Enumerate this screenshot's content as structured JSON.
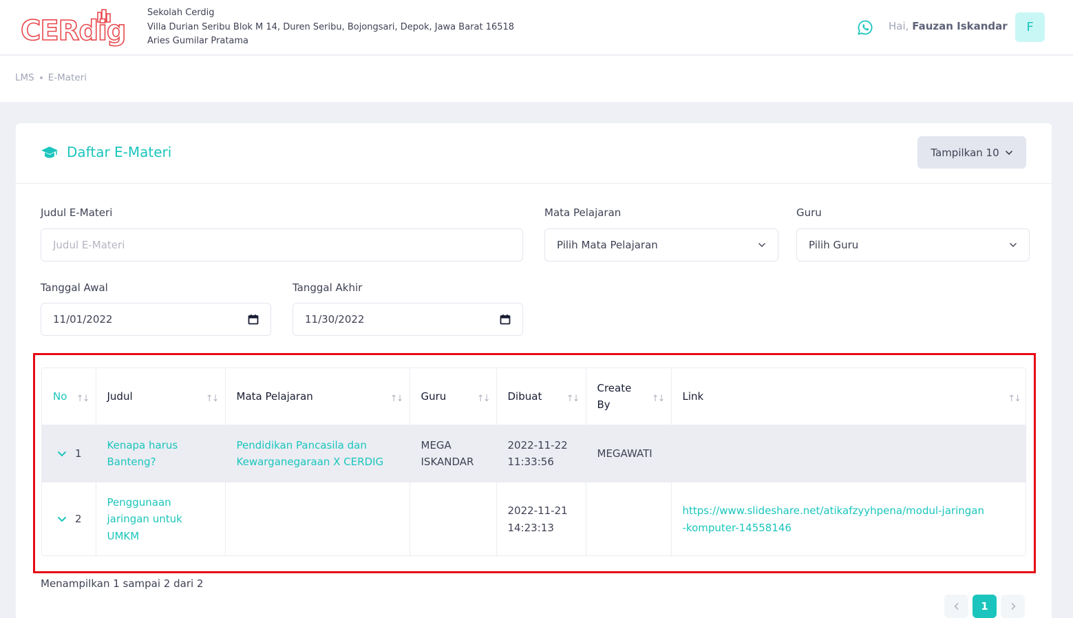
{
  "header": {
    "logo_text": "CERdig",
    "school_name": "Sekolah Cerdig",
    "school_address": "Villa Durian Seribu Blok M 14, Duren Seribu, Bojongsari, Depok, Jawa Barat 16518",
    "principal": "Aries Gumilar Pratama",
    "greeting": "Hai,",
    "user_name": "Fauzan Iskandar",
    "avatar_initial": "F"
  },
  "breadcrumb": [
    "LMS",
    "E-Materi"
  ],
  "card": {
    "title": "Daftar E-Materi",
    "show_button": "Tampilkan 10"
  },
  "filters": {
    "judul_label": "Judul E-Materi",
    "judul_placeholder": "Judul E-Materi",
    "mapel_label": "Mata Pelajaran",
    "mapel_value": "Pilih Mata Pelajaran",
    "guru_label": "Guru",
    "guru_value": "Pilih Guru",
    "tgl_awal_label": "Tanggal Awal",
    "tgl_awal_value": "11/01/2022",
    "tgl_akhir_label": "Tanggal Akhir",
    "tgl_akhir_value": "11/30/2022"
  },
  "table": {
    "columns": [
      "No",
      "Judul",
      "Mata Pelajaran",
      "Guru",
      "Dibuat",
      "Create By",
      "Link"
    ],
    "rows": [
      {
        "no": "1",
        "judul": "Kenapa harus Banteng?",
        "mapel": "Pendidikan Pancasila dan Kewarganegaraan X CERDIG",
        "guru": "MEGA ISKANDAR",
        "dibuat": "2022-11-22 11:33:56",
        "create_by": "MEGAWATI",
        "link": ""
      },
      {
        "no": "2",
        "judul": "Penggunaan jaringan untuk UMKM",
        "mapel": "",
        "guru": "",
        "dibuat": "2022-11-21 14:23:13",
        "create_by": "",
        "link": "https://www.slideshare.net/atikafzyyhpena/modul-jaringan-komputer-14558146"
      }
    ]
  },
  "footer": {
    "summary": "Menampilkan 1 sampai 2 dari 2",
    "current_page": "1"
  },
  "colors": {
    "accent": "#1bc5bd",
    "logo": "#e8474c",
    "highlight": "#e50914"
  }
}
